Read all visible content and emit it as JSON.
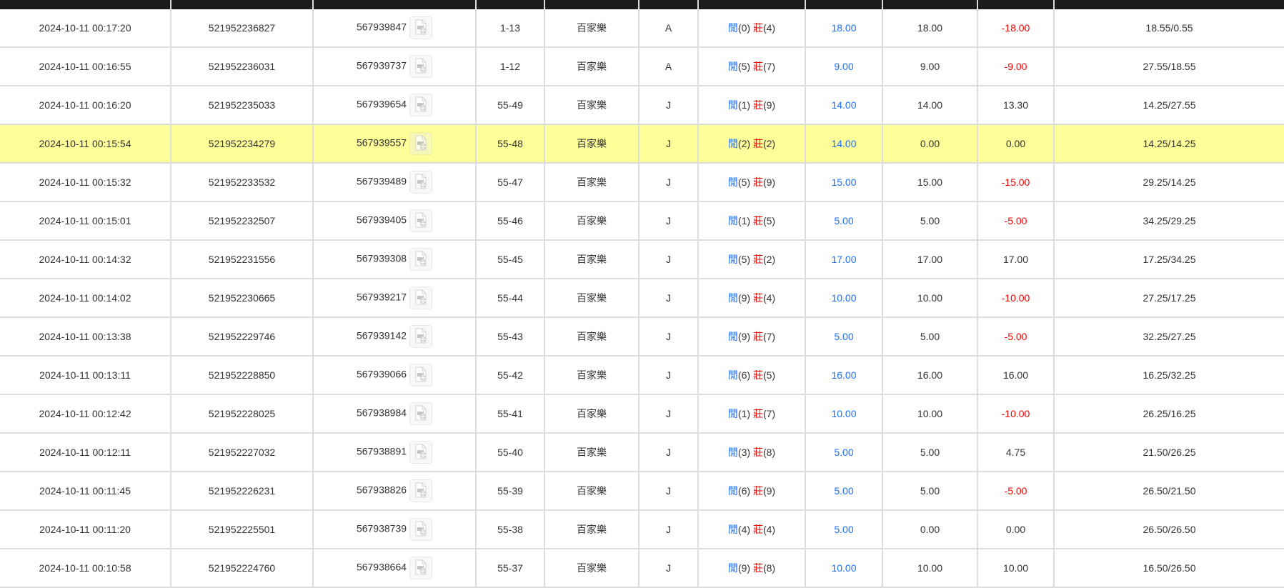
{
  "columns": [
    "",
    "",
    "",
    "",
    "",
    "",
    "",
    "",
    "",
    "",
    ""
  ],
  "colors": {
    "header_bg": "#1c1c1c",
    "highlight": "#ffff99",
    "player_blue": "#1a6fff",
    "banker_red": "#ff0000",
    "loss_red": "#ff0000"
  },
  "labels": {
    "player": "閒",
    "banker": "莊"
  },
  "rows": [
    {
      "time": "2024-10-11 00:17:20",
      "order": "521952236827",
      "round": "567939847",
      "shoe": "1-13",
      "game": "百家樂",
      "table": "A",
      "p": "(0)",
      "b": "(4)",
      "bet": "18.00",
      "valid": "18.00",
      "win": "-18.00",
      "balance": "18.55/0.55"
    },
    {
      "time": "2024-10-11 00:16:55",
      "order": "521952236031",
      "round": "567939737",
      "shoe": "1-12",
      "game": "百家樂",
      "table": "A",
      "p": "(5)",
      "b": "(7)",
      "bet": "9.00",
      "valid": "9.00",
      "win": "-9.00",
      "balance": "27.55/18.55"
    },
    {
      "time": "2024-10-11 00:16:20",
      "order": "521952235033",
      "round": "567939654",
      "shoe": "55-49",
      "game": "百家樂",
      "table": "J",
      "p": "(1)",
      "b": "(9)",
      "bet": "14.00",
      "valid": "14.00",
      "win": "13.30",
      "balance": "14.25/27.55"
    },
    {
      "time": "2024-10-11 00:15:54",
      "order": "521952234279",
      "round": "567939557",
      "shoe": "55-48",
      "game": "百家樂",
      "table": "J",
      "p": "(2)",
      "b": "(2)",
      "bet": "14.00",
      "valid": "0.00",
      "win": "0.00",
      "balance": "14.25/14.25",
      "highlight": true
    },
    {
      "time": "2024-10-11 00:15:32",
      "order": "521952233532",
      "round": "567939489",
      "shoe": "55-47",
      "game": "百家樂",
      "table": "J",
      "p": "(5)",
      "b": "(9)",
      "bet": "15.00",
      "valid": "15.00",
      "win": "-15.00",
      "balance": "29.25/14.25"
    },
    {
      "time": "2024-10-11 00:15:01",
      "order": "521952232507",
      "round": "567939405",
      "shoe": "55-46",
      "game": "百家樂",
      "table": "J",
      "p": "(1)",
      "b": "(5)",
      "bet": "5.00",
      "valid": "5.00",
      "win": "-5.00",
      "balance": "34.25/29.25"
    },
    {
      "time": "2024-10-11 00:14:32",
      "order": "521952231556",
      "round": "567939308",
      "shoe": "55-45",
      "game": "百家樂",
      "table": "J",
      "p": "(5)",
      "b": "(2)",
      "bet": "17.00",
      "valid": "17.00",
      "win": "17.00",
      "balance": "17.25/34.25"
    },
    {
      "time": "2024-10-11 00:14:02",
      "order": "521952230665",
      "round": "567939217",
      "shoe": "55-44",
      "game": "百家樂",
      "table": "J",
      "p": "(9)",
      "b": "(4)",
      "bet": "10.00",
      "valid": "10.00",
      "win": "-10.00",
      "balance": "27.25/17.25"
    },
    {
      "time": "2024-10-11 00:13:38",
      "order": "521952229746",
      "round": "567939142",
      "shoe": "55-43",
      "game": "百家樂",
      "table": "J",
      "p": "(9)",
      "b": "(7)",
      "bet": "5.00",
      "valid": "5.00",
      "win": "-5.00",
      "balance": "32.25/27.25"
    },
    {
      "time": "2024-10-11 00:13:11",
      "order": "521952228850",
      "round": "567939066",
      "shoe": "55-42",
      "game": "百家樂",
      "table": "J",
      "p": "(6)",
      "b": "(5)",
      "bet": "16.00",
      "valid": "16.00",
      "win": "16.00",
      "balance": "16.25/32.25"
    },
    {
      "time": "2024-10-11 00:12:42",
      "order": "521952228025",
      "round": "567938984",
      "shoe": "55-41",
      "game": "百家樂",
      "table": "J",
      "p": "(1)",
      "b": "(7)",
      "bet": "10.00",
      "valid": "10.00",
      "win": "-10.00",
      "balance": "26.25/16.25"
    },
    {
      "time": "2024-10-11 00:12:11",
      "order": "521952227032",
      "round": "567938891",
      "shoe": "55-40",
      "game": "百家樂",
      "table": "J",
      "p": "(3)",
      "b": "(8)",
      "bet": "5.00",
      "valid": "5.00",
      "win": "4.75",
      "balance": "21.50/26.25"
    },
    {
      "time": "2024-10-11 00:11:45",
      "order": "521952226231",
      "round": "567938826",
      "shoe": "55-39",
      "game": "百家樂",
      "table": "J",
      "p": "(6)",
      "b": "(9)",
      "bet": "5.00",
      "valid": "5.00",
      "win": "-5.00",
      "balance": "26.50/21.50"
    },
    {
      "time": "2024-10-11 00:11:20",
      "order": "521952225501",
      "round": "567938739",
      "shoe": "55-38",
      "game": "百家樂",
      "table": "J",
      "p": "(4)",
      "b": "(4)",
      "bet": "5.00",
      "valid": "0.00",
      "win": "0.00",
      "balance": "26.50/26.50"
    },
    {
      "time": "2024-10-11 00:10:58",
      "order": "521952224760",
      "round": "567938664",
      "shoe": "55-37",
      "game": "百家樂",
      "table": "J",
      "p": "(9)",
      "b": "(8)",
      "bet": "10.00",
      "valid": "10.00",
      "win": "10.00",
      "balance": "16.50/26.50"
    }
  ]
}
